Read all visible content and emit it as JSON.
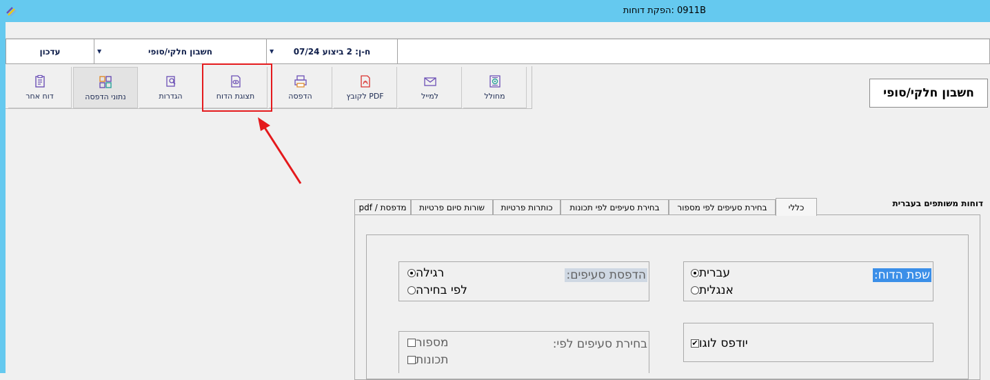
{
  "window": {
    "title": "0911B :הפקת דוחות"
  },
  "combos": {
    "update": "עדכון",
    "report_type": "חשבון חלקי/סופי",
    "account": "ח-ן: 2 ביצוע 07/24"
  },
  "toolbar": {
    "other_report": "דוח אחר",
    "print_data": "נתוני הדפסה",
    "settings": "הגדרות",
    "report_view": "תצוגת הדוח",
    "print": "הדפסה",
    "pdf_file": "PDF לקובץ",
    "email": "למייל",
    "generator": "מחולל"
  },
  "report_title": "חשבון חלקי/סופי",
  "section_label": "דוחות משותפים בעברית",
  "tabs": [
    {
      "label": "כללי",
      "selected": true
    },
    {
      "label": "בחירת סעיפים לפי מספור",
      "selected": false
    },
    {
      "label": "בחירת סעיפים לפי תכונות",
      "selected": false
    },
    {
      "label": "כותרות פרטיות",
      "selected": false
    },
    {
      "label": "שורות סיום פרטיות",
      "selected": false
    },
    {
      "label": "מדפסת / pdf",
      "selected": false
    }
  ],
  "language_group": {
    "title": "שפת הדוח:",
    "options": [
      {
        "label": "עברית",
        "checked": true
      },
      {
        "label": "אנגלית",
        "checked": false
      }
    ]
  },
  "print_sections_group": {
    "title": "הדפסת סעיפים:",
    "options": [
      {
        "label": "רגילה",
        "checked": true
      },
      {
        "label": "לפי בחירה",
        "checked": false
      }
    ]
  },
  "logo_group": {
    "label": "יודפס לוגו",
    "checked": true
  },
  "select_by_group": {
    "title": "בחירת סעיפים לפי:",
    "options": [
      {
        "label": "מספור",
        "checked": false
      },
      {
        "label": "תכונות",
        "checked": false
      }
    ]
  },
  "colors": {
    "titlebar": "#65c9ef",
    "highlight": "#e4191c",
    "selection": "#3b8fe8"
  }
}
